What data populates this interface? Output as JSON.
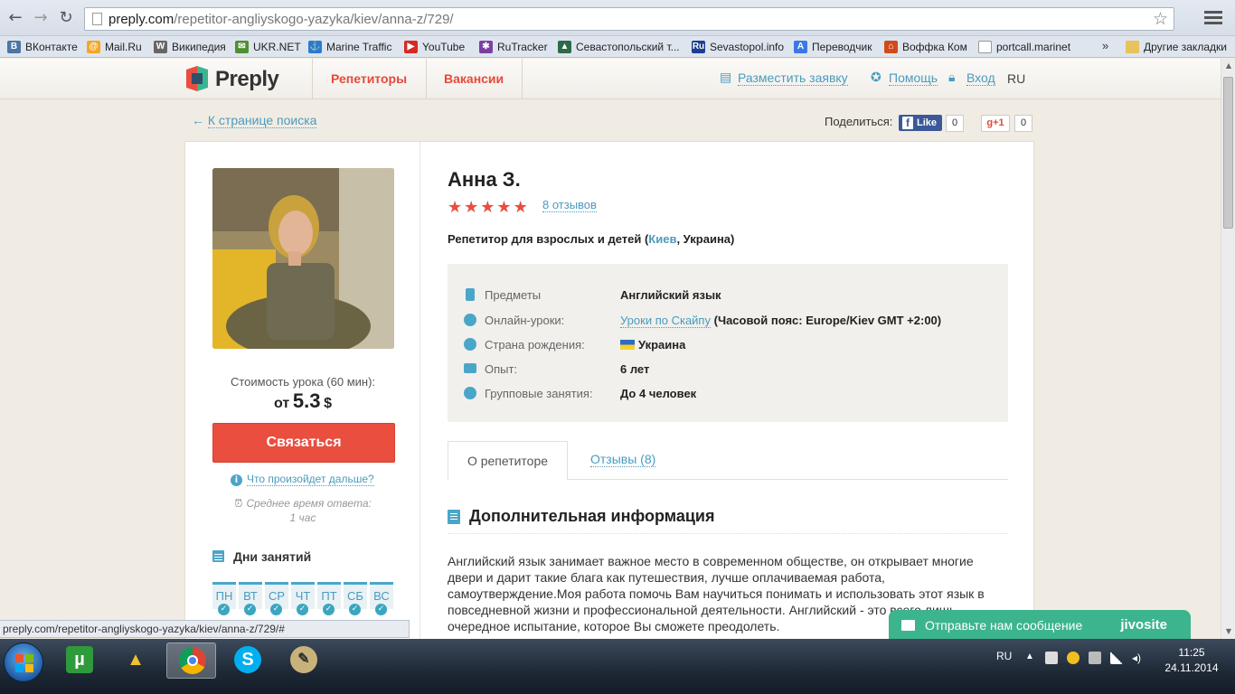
{
  "browser": {
    "url_host": "preply.com",
    "url_path": "/repetitor-angliyskogo-yazyka/kiev/anna-z/729/",
    "bookmarks": [
      {
        "label": "ВКонтакте",
        "icon": "vk-icon",
        "color": "#4c75a3",
        "glyph": "В"
      },
      {
        "label": "Mail.Ru",
        "icon": "mailru-icon",
        "color": "#f5a623",
        "glyph": "@"
      },
      {
        "label": "Википедия",
        "icon": "wikipedia-icon",
        "color": "#666666",
        "glyph": "W"
      },
      {
        "label": "UKR.NET",
        "icon": "ukrnet-icon",
        "color": "#4e8f2f",
        "glyph": "✉"
      },
      {
        "label": "Marine Traffic",
        "icon": "marinetraffic-icon",
        "color": "#2b7ad1",
        "glyph": "⚓"
      },
      {
        "label": "YouTube",
        "icon": "youtube-icon",
        "color": "#d62a22",
        "glyph": "▶"
      },
      {
        "label": "RuTracker",
        "icon": "rutracker-icon",
        "color": "#7a3fa0",
        "glyph": "✱"
      },
      {
        "label": "Севастопольский т...",
        "icon": "sevastopol-icon",
        "color": "#2e6a4a",
        "glyph": "▲"
      },
      {
        "label": "Sevastopol.info",
        "icon": "sevastopolinfo-icon",
        "color": "#1c3f8f",
        "glyph": "Ru"
      },
      {
        "label": "Переводчик",
        "icon": "translate-icon",
        "color": "#3b78e7",
        "glyph": "A"
      },
      {
        "label": "Воффка Ком",
        "icon": "home-icon",
        "color": "#d04a1a",
        "glyph": "⌂"
      },
      {
        "label": "portcall.marinet",
        "icon": "page-icon",
        "color": "#ffffff",
        "glyph": ""
      }
    ],
    "bookmarks_more": "»",
    "other_bookmarks": "Другие закладки",
    "status_url": "preply.com/repetitor-angliyskogo-yazyka/kiev/anna-z/729/#"
  },
  "header": {
    "logo": "Preply",
    "nav_tutors": "Репетиторы",
    "nav_vacancies": "Вакансии",
    "post_request": "Разместить заявку",
    "help": "Помощь",
    "login": "Вход",
    "lang": "RU"
  },
  "page": {
    "back_link": "К странице поиска",
    "share_label": "Поделиться:",
    "fb_like": "Like",
    "fb_count": "0",
    "gplus": "+1",
    "gplus_count": "0"
  },
  "tutor": {
    "name": "Анна З.",
    "rating_stars": 5,
    "reviews_link": "8 отзывов",
    "tagline_pre": "Репетитор для взрослых и детей (",
    "city": "Киев",
    "tagline_post": ", Украина)",
    "price_label": "Стоимость урока (60 мин):",
    "price_prefix": "от",
    "price_value": "5.3",
    "price_currency": "$",
    "contact_button": "Связаться",
    "whats_next": "Что произойдет дальше?",
    "response_label": "Среднее время ответа:",
    "response_value": "1 час",
    "days_title": "Дни занятий",
    "days": [
      "ПН",
      "ВТ",
      "СР",
      "ЧТ",
      "ПТ",
      "СБ",
      "ВС"
    ]
  },
  "info": {
    "subjects_label": "Предметы",
    "subjects_value": "Английский язык",
    "online_label": "Онлайн-уроки:",
    "online_link": "Уроки по Скайпу",
    "online_tz": "(Часовой пояс: Europe/Kiev GMT +2:00)",
    "country_label": "Страна рождения:",
    "country_value": "Украина",
    "experience_label": "Опыт:",
    "experience_value": "6 лет",
    "group_label": "Групповые занятия:",
    "group_value": "До 4 человек"
  },
  "tabs": {
    "about": "О репетиторе",
    "reviews": "Отзывы (8)"
  },
  "about": {
    "title": "Дополнительная информация",
    "text": "Английский язык занимает важное место в современном обществе, он открывает многие двери и дарит такие блага как путешествия, лучше оплачиваемая работа, самоутверждение.Моя работа помочь Вам научиться понимать и использовать этот язык в повседневной жизни и профессиональной деятельности. Английский - это всего лишь очередное испытание, которое Вы сможете преодолеть."
  },
  "jivo": {
    "label": "Отправьте нам сообщение",
    "brand": "jivosite"
  },
  "taskbar": {
    "apps": [
      "utorrent-icon",
      "aimp-icon",
      "chrome-icon",
      "skype-icon",
      "paint-icon"
    ],
    "tray_lang": "RU",
    "time": "11:25",
    "date": "24.11.2014"
  },
  "colors": {
    "accent_red": "#e94e3f",
    "link_blue": "#4a9bbf",
    "jivo_green": "#3cb48d"
  }
}
